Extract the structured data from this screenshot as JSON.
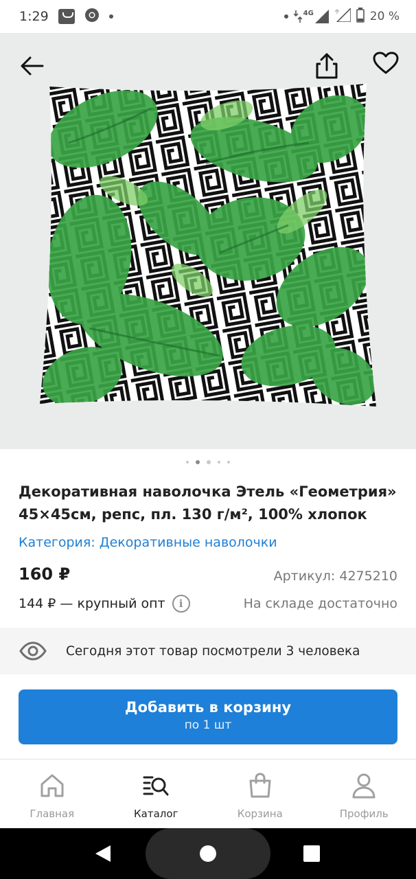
{
  "status_bar": {
    "time": "1:29",
    "network": "4G",
    "battery": "20 %"
  },
  "product": {
    "title": "Декоративная наволочка Этель «Геометрия» 45×45см, репс, пл. 130 г/м², 100% хлопок",
    "category": "Категория: Декоративные наволочки",
    "price": "160 ₽",
    "sku": "Артикул: 4275210",
    "wholesale": "144 ₽ — крупный опт",
    "stock": "На складе достаточно"
  },
  "gallery": {
    "active_index": 1,
    "count": 5
  },
  "views_notice": "Сегодня этот товар посмотрели 3 человека",
  "cart_button": {
    "label": "Добавить в корзину",
    "sub": "по 1 шт"
  },
  "tabbar": {
    "items": [
      {
        "label": "Главная",
        "icon": "home-icon"
      },
      {
        "label": "Каталог",
        "icon": "catalog-search-icon"
      },
      {
        "label": "Корзина",
        "icon": "bag-icon"
      },
      {
        "label": "Профиль",
        "icon": "profile-icon"
      }
    ],
    "active": "Каталог"
  },
  "colors": {
    "accent": "#1e80d8",
    "link": "#1f7fd4",
    "leaf": "#3aa546"
  }
}
